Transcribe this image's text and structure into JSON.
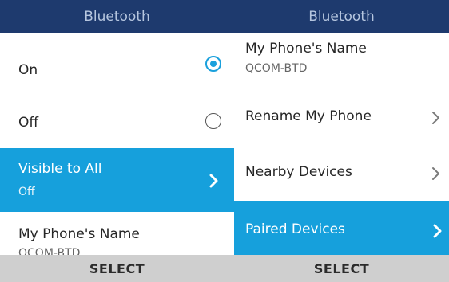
{
  "left": {
    "header": "Bluetooth",
    "items": [
      {
        "title": "On"
      },
      {
        "title": "Off"
      },
      {
        "title": "Visible to All",
        "sub": "Off"
      },
      {
        "title": "My Phone's Name",
        "sub": "QCOM-BTD"
      }
    ],
    "softkey": "SELECT"
  },
  "right": {
    "header": "Bluetooth",
    "items": [
      {
        "title": "My Phone's Name",
        "sub": "QCOM-BTD"
      },
      {
        "title": "Rename My Phone"
      },
      {
        "title": "Nearby Devices"
      },
      {
        "title": "Paired Devices"
      }
    ],
    "softkey": "SELECT"
  },
  "colors": {
    "header_bg": "#1e3a6e",
    "accent": "#16a0dc",
    "softkey_bg": "#cfcfcf"
  }
}
